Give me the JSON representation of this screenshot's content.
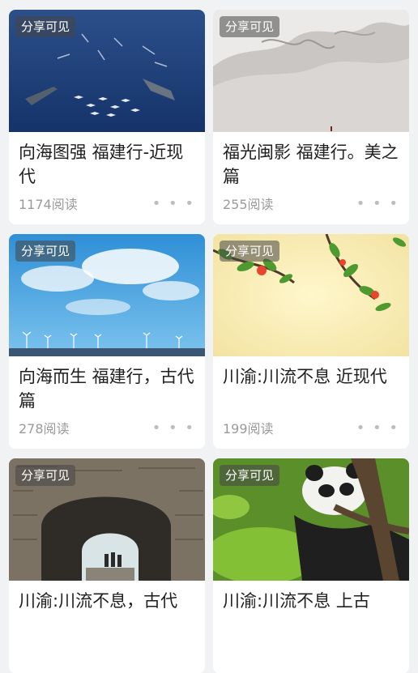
{
  "cards": [
    {
      "badge": "分享可见",
      "title": "向海图强 福建行-近现代",
      "reads": "1174阅读",
      "more": "• • •",
      "image": "aircraft-carrier-fleet"
    },
    {
      "badge": "分享可见",
      "title": "福光闽影 福建行。美之篇",
      "reads": "255阅读",
      "more": "• • •",
      "image": "ink-landscape"
    },
    {
      "badge": "分享可见",
      "title": "向海而生 福建行，古代篇",
      "reads": "278阅读",
      "more": "• • •",
      "image": "wind-turbines-sea"
    },
    {
      "badge": "分享可见",
      "title": "川渝:川流不息 近现代",
      "reads": "199阅读",
      "more": "• • •",
      "image": "blossom-branch"
    },
    {
      "badge": "分享可见",
      "title": "川渝:川流不息，古代",
      "reads": "",
      "more": "",
      "image": "stone-arch-gate"
    },
    {
      "badge": "分享可见",
      "title": "川渝:川流不息 上古",
      "reads": "",
      "more": "",
      "image": "panda-tree"
    }
  ]
}
